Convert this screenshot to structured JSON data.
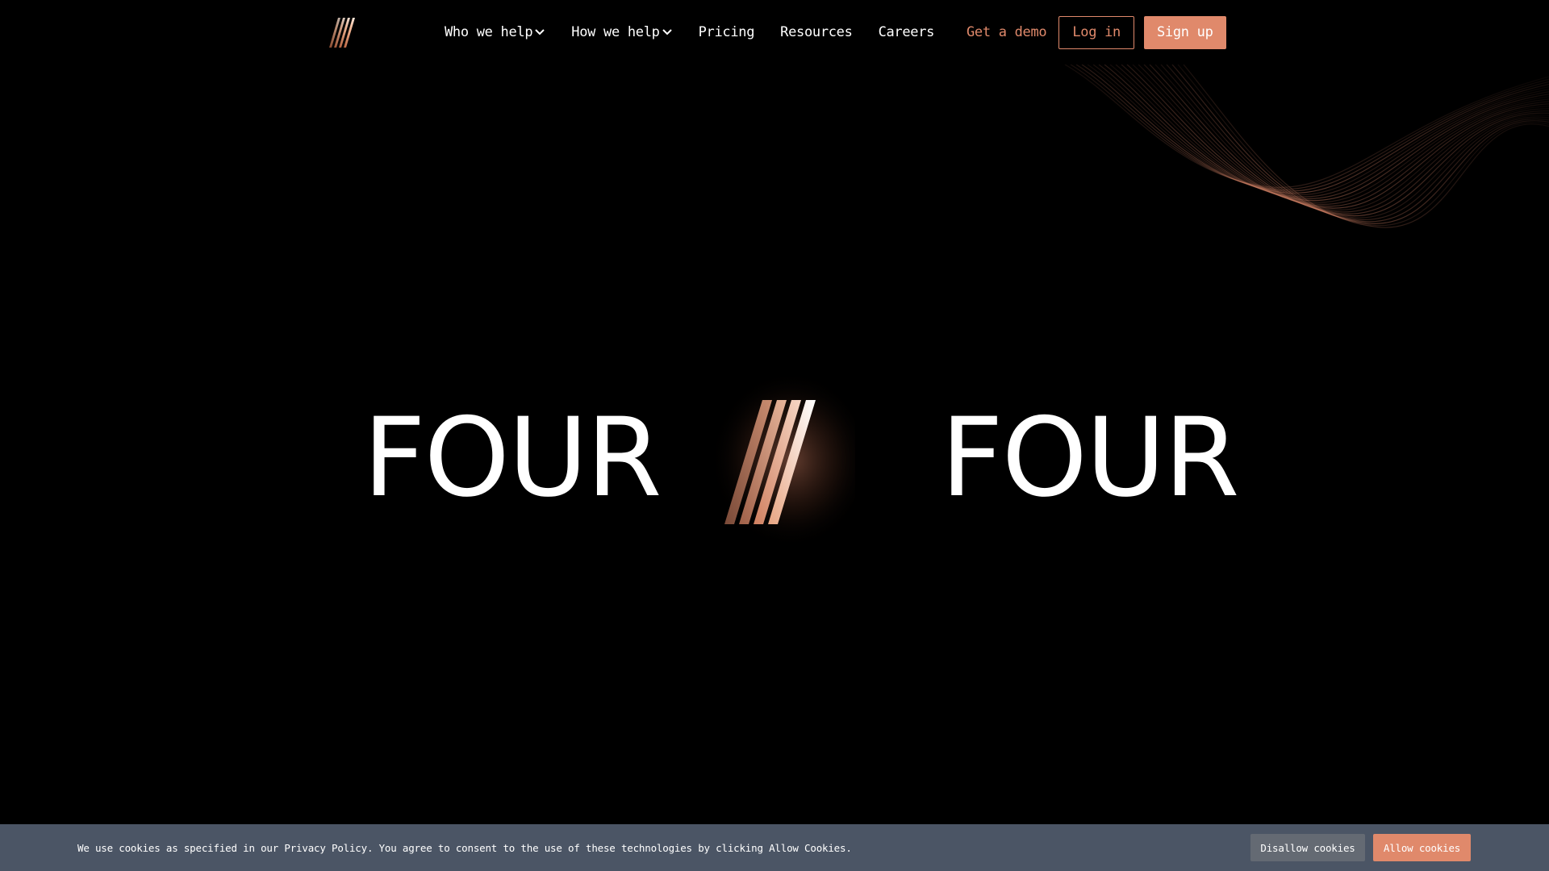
{
  "header": {
    "logo_icon": "four-slashes-logo-icon",
    "nav": [
      {
        "label": "Who we help",
        "dropdown": true
      },
      {
        "label": "How we help",
        "dropdown": true
      },
      {
        "label": "Pricing",
        "dropdown": false
      },
      {
        "label": "Resources",
        "dropdown": false
      },
      {
        "label": "Careers",
        "dropdown": false
      }
    ],
    "get_demo_label": "Get a demo",
    "login_label": "Log in",
    "signup_label": "Sign up"
  },
  "hero": {
    "left_word": "FOUR",
    "right_word": "FOUR",
    "center_icon": "four-slashes-zero-icon"
  },
  "cookie_banner": {
    "text": "We use cookies as specified in our Privacy Policy. You agree to consent to the use of these technologies by clicking Allow Cookies.",
    "disallow_label": "Disallow cookies",
    "allow_label": "Allow cookies"
  },
  "colors": {
    "accent": "#e0896b",
    "background": "#000000",
    "cookie_bar": "#4b5565",
    "disallow_button": "#646a73",
    "text": "#ffffff"
  }
}
